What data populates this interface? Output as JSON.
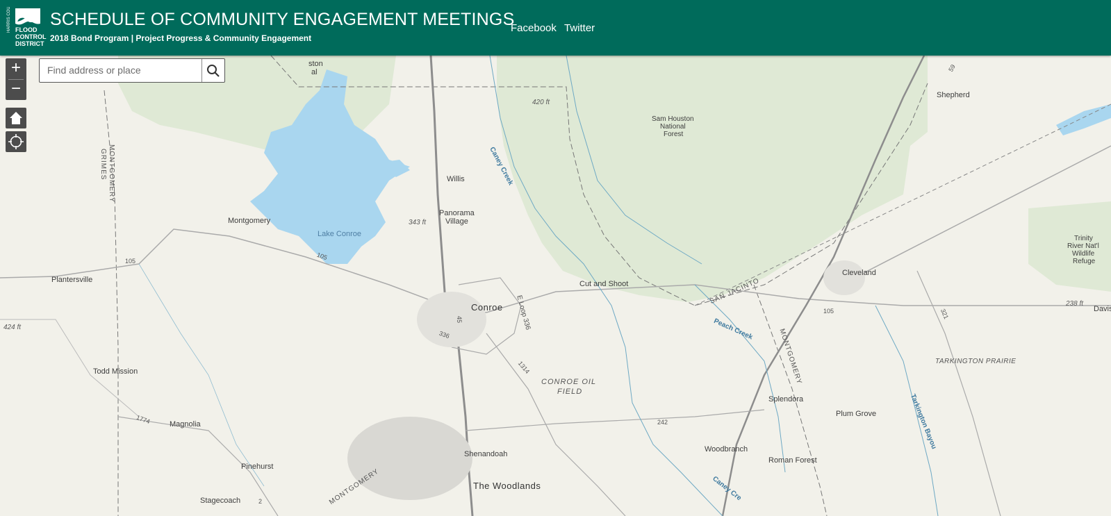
{
  "header": {
    "logo_text": [
      "HARRIS COUNTY",
      "FLOOD",
      "CONTROL",
      "DISTRICT"
    ],
    "title": "SCHEDULE OF COMMUNITY ENGAGEMENT MEETINGS",
    "subtitle": "2018 Bond Program | Project Progress & Community Engagement",
    "links": [
      "Facebook",
      "Twitter"
    ],
    "bg_color": "#006b5b"
  },
  "controls": {
    "zoom_in": "+",
    "zoom_out": "−",
    "home_icon": "home-icon",
    "locate_icon": "locate-icon"
  },
  "search": {
    "placeholder": "Find address or place",
    "icon": "search-icon"
  },
  "map": {
    "places": {
      "conroe": "Conroe",
      "the_woodlands": "The Woodlands",
      "willis": "Willis",
      "panorama": "Panorama",
      "village": "Village",
      "montgomery": "Montgomery",
      "plantersville": "Plantersville",
      "todd_mission": "Todd Mission",
      "magnolia": "Magnolia",
      "pinehurst": "Pinehurst",
      "stagecoach": "Stagecoach",
      "shenandoah": "Shenandoah",
      "cut_and_shoot": "Cut and Shoot",
      "splendora": "Splendora",
      "plum_grove": "Plum Grove",
      "woodbranch": "Woodbranch",
      "roman_forest": "Roman Forest",
      "cleveland": "Cleveland",
      "shepherd": "Shepherd",
      "davis": "Davis"
    },
    "features": {
      "lake_conroe": "Lake Conroe",
      "sam_houston": [
        "Sam Houston",
        "National",
        "Forest"
      ],
      "trinity": [
        "Trinity",
        "River Nat'l",
        "Wildlife",
        "Refuge"
      ],
      "conroe_oil": [
        "CONROE OIL",
        "FIELD"
      ],
      "tarkington_prairie": "TARKINGTON PRAIRIE",
      "caney_creek": "Caney Creek",
      "caney_creek_2": "Caney Cre",
      "peach_creek": "Peach Creek",
      "tarkington_bayou": "Tarkington Bayou",
      "montgomery_county": "MONTGOMERY",
      "grimes": "GRIMES",
      "montgomery_east": "MONTGOMERY",
      "montgomery_south": "MONTGOMERY",
      "san_jacinto": "SAN JACINTO",
      "ston": "ston",
      "al": "al"
    },
    "elevations": {
      "e420": "420 ft",
      "e343": "343 ft",
      "e424": "424 ft",
      "e238": "238 ft"
    },
    "highways": {
      "h105a": "105",
      "h105b": "105",
      "h105c": "105",
      "h45": "45",
      "h336": "336",
      "h1314": "1314",
      "h1774": "1774",
      "h242": "242",
      "h321": "321",
      "h59": "59",
      "h2": "2",
      "loop336": "E Loop 336"
    },
    "colors": {
      "forest": "#dde8d2",
      "water": "#a9d6ef",
      "road": "#9a9a9a",
      "base": "#f2f1ea"
    }
  }
}
